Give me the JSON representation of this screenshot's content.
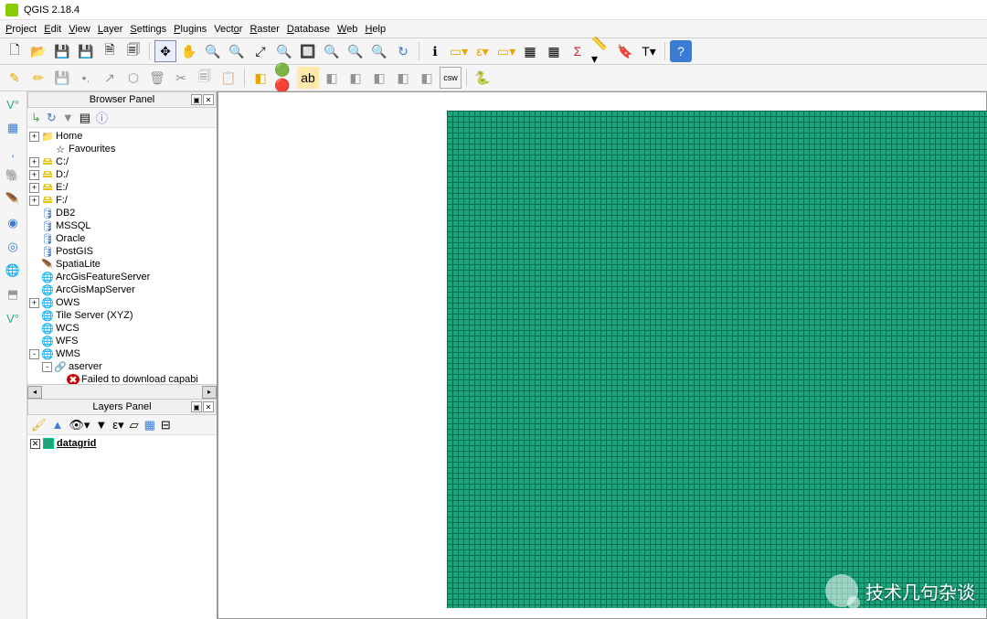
{
  "title": "QGIS 2.18.4",
  "menu": [
    "Project",
    "Edit",
    "View",
    "Layer",
    "Settings",
    "Plugins",
    "Vector",
    "Raster",
    "Database",
    "Web",
    "Help"
  ],
  "browser_panel": {
    "title": "Browser Panel",
    "items": [
      {
        "expand": "+",
        "indent": 0,
        "icon": "folder",
        "label": "Home"
      },
      {
        "expand": "",
        "indent": 1,
        "icon": "star",
        "label": "Favourites"
      },
      {
        "expand": "+",
        "indent": 0,
        "icon": "drive",
        "label": "C:/"
      },
      {
        "expand": "+",
        "indent": 0,
        "icon": "drive",
        "label": "D:/"
      },
      {
        "expand": "+",
        "indent": 0,
        "icon": "drive",
        "label": "E:/"
      },
      {
        "expand": "+",
        "indent": 0,
        "icon": "drive",
        "label": "F:/"
      },
      {
        "expand": "",
        "indent": 0,
        "icon": "db",
        "label": "DB2"
      },
      {
        "expand": "",
        "indent": 0,
        "icon": "db",
        "label": "MSSQL"
      },
      {
        "expand": "",
        "indent": 0,
        "icon": "db",
        "label": "Oracle"
      },
      {
        "expand": "",
        "indent": 0,
        "icon": "db",
        "label": "PostGIS"
      },
      {
        "expand": "",
        "indent": 0,
        "icon": "feather",
        "label": "SpatiaLite"
      },
      {
        "expand": "",
        "indent": 0,
        "icon": "globe",
        "label": "ArcGisFeatureServer"
      },
      {
        "expand": "",
        "indent": 0,
        "icon": "globe",
        "label": "ArcGisMapServer"
      },
      {
        "expand": "+",
        "indent": 0,
        "icon": "globe",
        "label": "OWS"
      },
      {
        "expand": "",
        "indent": 0,
        "icon": "globe",
        "label": "Tile Server (XYZ)"
      },
      {
        "expand": "",
        "indent": 0,
        "icon": "globe",
        "label": "WCS"
      },
      {
        "expand": "",
        "indent": 0,
        "icon": "globe",
        "label": "WFS"
      },
      {
        "expand": "-",
        "indent": 0,
        "icon": "globe",
        "label": "WMS"
      },
      {
        "expand": "-",
        "indent": 1,
        "icon": "link",
        "label": "aserver"
      },
      {
        "expand": "",
        "indent": 2,
        "icon": "error",
        "label": "Failed to download capabi"
      }
    ]
  },
  "layers_panel": {
    "title": "Layers Panel",
    "layer": {
      "checked": true,
      "name": "datagrid"
    }
  },
  "watermark": "技术几句杂谈"
}
